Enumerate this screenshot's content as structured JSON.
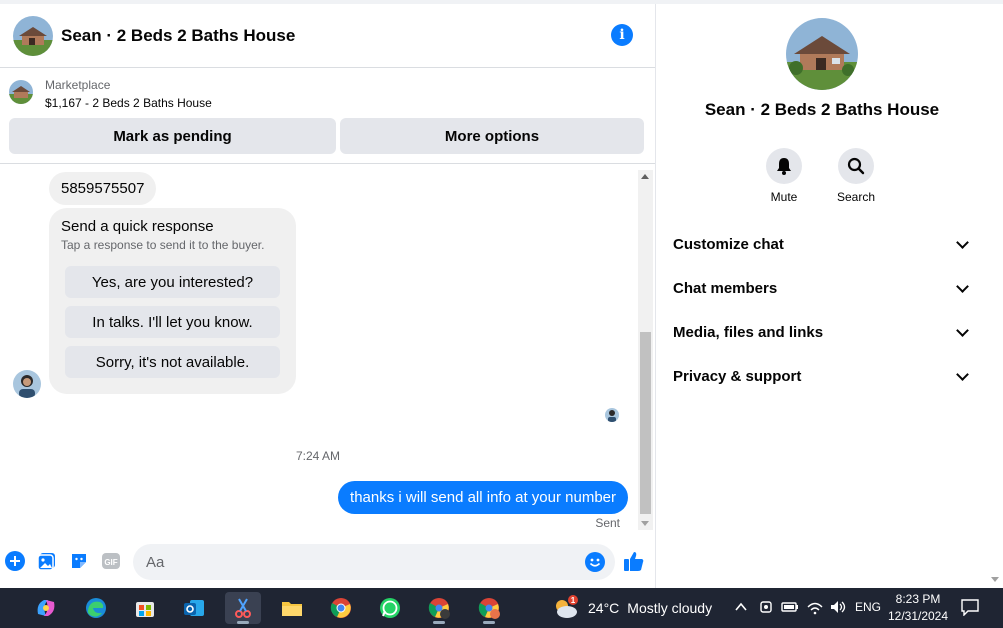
{
  "chat": {
    "title": "Sean · 2 Beds 2 Baths House",
    "marketplace": {
      "label": "Marketplace",
      "item": "$1,167 - 2 Beds 2 Baths House",
      "mark_pending": "Mark as pending",
      "more_options": "More options"
    },
    "messages": {
      "phone": "5859575507",
      "quick_response": {
        "title": "Send a quick response",
        "subtitle": "Tap a response to send it to the buyer.",
        "options": [
          "Yes, are you interested?",
          "In talks. I'll let you know.",
          "Sorry, it's not available."
        ]
      },
      "timestamp": "7:24 AM",
      "outgoing": "thanks i will send all info at your number",
      "status": "Sent"
    },
    "composer": {
      "placeholder": "Aa",
      "icons": [
        "plus-icon",
        "gallery-icon",
        "sticker-icon",
        "gif-icon",
        "emoji-icon",
        "like-icon"
      ],
      "gif_label": "GIF"
    }
  },
  "info": {
    "name": "Sean · 2 Beds 2 Baths House",
    "actions": [
      {
        "label": "Mute",
        "icon": "bell-icon"
      },
      {
        "label": "Search",
        "icon": "search-icon"
      }
    ],
    "sections": [
      "Customize chat",
      "Chat members",
      "Media, files and links",
      "Privacy & support"
    ]
  },
  "taskbar": {
    "weather": {
      "temp": "24°C",
      "condition": "Mostly cloudy",
      "badge": "1"
    },
    "language": "ENG",
    "time": "8:23 PM",
    "date": "12/31/2024"
  },
  "colors": {
    "accent": "#0a7cff",
    "bubble_in": "#f0f0f0",
    "button_bg": "#e4e6eb",
    "taskbar": "#1f2533"
  }
}
